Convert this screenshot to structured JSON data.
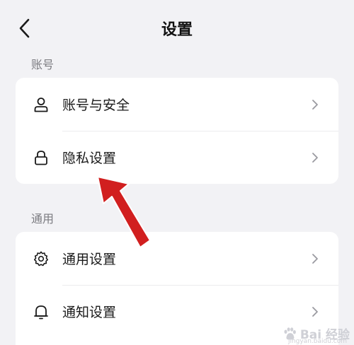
{
  "header": {
    "title": "设置",
    "back_icon": "chevron-left-icon"
  },
  "sections": [
    {
      "label": "账号",
      "items": [
        {
          "label": "账号与安全",
          "icon": "user-icon"
        },
        {
          "label": "隐私设置",
          "icon": "lock-icon"
        }
      ]
    },
    {
      "label": "通用",
      "items": [
        {
          "label": "通用设置",
          "icon": "gear-icon"
        },
        {
          "label": "通知设置",
          "icon": "bell-icon"
        }
      ]
    }
  ],
  "colors": {
    "background": "#f2f2f5",
    "card": "#ffffff",
    "annotation_arrow": "#d11f1f",
    "section_label": "#7b7b80"
  },
  "watermark": {
    "text": "Bai 经验",
    "sub": "jingyan.baidu.com"
  }
}
